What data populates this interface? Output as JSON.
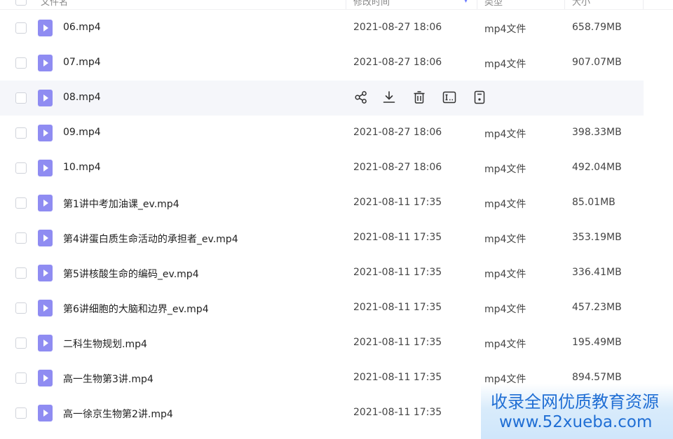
{
  "header": {
    "columns": [
      "文件名",
      "修改时间",
      "类型",
      "大小"
    ]
  },
  "rows": [
    {
      "name": "06.mp4",
      "date": "2021-08-27 18:06",
      "type": "mp4文件",
      "size": "658.79MB"
    },
    {
      "name": "07.mp4",
      "date": "2021-08-27 18:06",
      "type": "mp4文件",
      "size": "907.07MB"
    },
    {
      "name": "08.mp4",
      "date": "",
      "type": "",
      "size": ""
    },
    {
      "name": "09.mp4",
      "date": "2021-08-27 18:06",
      "type": "mp4文件",
      "size": "398.33MB"
    },
    {
      "name": "10.mp4",
      "date": "2021-08-27 18:06",
      "type": "mp4文件",
      "size": "492.04MB"
    },
    {
      "name": "第1讲中考加油课_ev.mp4",
      "date": "2021-08-11 17:35",
      "type": "mp4文件",
      "size": "85.01MB"
    },
    {
      "name": "第4讲蛋白质生命活动的承担者_ev.mp4",
      "date": "2021-08-11 17:35",
      "type": "mp4文件",
      "size": "353.19MB"
    },
    {
      "name": "第5讲核酸生命的编码_ev.mp4",
      "date": "2021-08-11 17:35",
      "type": "mp4文件",
      "size": "336.41MB"
    },
    {
      "name": "第6讲细胞的大脑和边界_ev.mp4",
      "date": "2021-08-11 17:35",
      "type": "mp4文件",
      "size": "457.23MB"
    },
    {
      "name": "二科生物规划.mp4",
      "date": "2021-08-11 17:35",
      "type": "mp4文件",
      "size": "195.49MB"
    },
    {
      "name": "高一生物第3讲.mp4",
      "date": "2021-08-11 17:35",
      "type": "mp4文件",
      "size": "894.57MB"
    },
    {
      "name": "高一徐京生物第2讲.mp4",
      "date": "2021-08-11 17:35",
      "type": "",
      "size": ""
    }
  ],
  "hover_actions": [
    "share-icon",
    "download-icon",
    "delete-icon",
    "rename-icon",
    "more-icon"
  ],
  "watermark": {
    "line1": "收录全网优质教育资源",
    "line2": "www.52xueba.com"
  },
  "colors": {
    "accent": "#6b7bff",
    "video_icon": "#8f8cf2",
    "hover_row": "#f5f6fa",
    "watermark_text": "#1f6ed4"
  }
}
